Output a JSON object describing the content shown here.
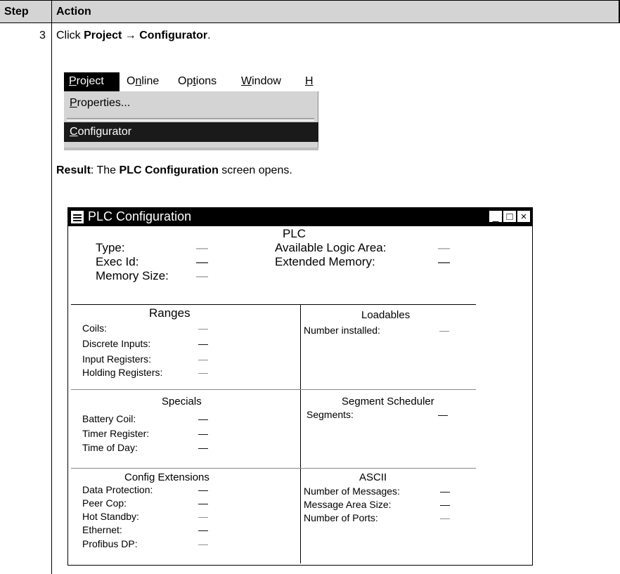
{
  "table": {
    "header_step": "Step",
    "header_action": "Action",
    "step_number": "3",
    "instruction_prefix": "Click ",
    "instruction_menu": "Project",
    "instruction_arrow": " → ",
    "instruction_item": "Configurator",
    "instruction_suffix": ".",
    "result_label": "Result",
    "result_text_1": ": The ",
    "result_screen": "PLC Configuration",
    "result_text_2": " screen opens."
  },
  "menu": {
    "bar_items": [
      "Project",
      "Online",
      "Options",
      "Window",
      "H"
    ],
    "dropdown_items": [
      "Properties...",
      "Configurator"
    ],
    "selected_item": "Configurator"
  },
  "window": {
    "title": "PLC Configuration",
    "buttons": [
      "_",
      "□",
      "×"
    ],
    "plc_section": {
      "heading": "PLC",
      "left": [
        {
          "label": "Type:",
          "value": "—"
        },
        {
          "label": "Exec Id:",
          "value": "—"
        },
        {
          "label": "Memory Size:",
          "value": "—"
        }
      ],
      "right": [
        {
          "label": "Available Logic Area:",
          "value": "—"
        },
        {
          "label": "Extended Memory:",
          "value": "—"
        }
      ]
    },
    "ranges": {
      "heading": "Ranges",
      "rows": [
        {
          "label": "Coils:",
          "value": "—"
        },
        {
          "label": "Discrete Inputs:",
          "value": "—"
        },
        {
          "label": "Input Registers:",
          "value": "—"
        },
        {
          "label": "Holding Registers:",
          "value": "—"
        }
      ]
    },
    "loadables": {
      "heading": "Loadables",
      "rows": [
        {
          "label": "Number installed:",
          "value": "—"
        }
      ]
    },
    "specials": {
      "heading": "Specials",
      "rows": [
        {
          "label": "Battery Coil:",
          "value": "—"
        },
        {
          "label": "Timer Register:",
          "value": "—"
        },
        {
          "label": "Time of Day:",
          "value": "—"
        }
      ]
    },
    "segment_scheduler": {
      "heading": "Segment Scheduler",
      "rows": [
        {
          "label": "Segments:",
          "value": "—"
        }
      ]
    },
    "config_extensions": {
      "heading": "Config Extensions",
      "rows": [
        {
          "label": "Data Protection:",
          "value": "—"
        },
        {
          "label": "Peer Cop:",
          "value": "—"
        },
        {
          "label": "Hot Standby:",
          "value": "—"
        },
        {
          "label": "Ethernet:",
          "value": "—"
        },
        {
          "label": "Profibus DP:",
          "value": "—"
        }
      ]
    },
    "ascii": {
      "heading": "ASCII",
      "rows": [
        {
          "label": "Number of Messages:",
          "value": "—"
        },
        {
          "label": "Message Area Size:",
          "value": "—"
        },
        {
          "label": "Number of Ports:",
          "value": "—"
        }
      ]
    }
  }
}
